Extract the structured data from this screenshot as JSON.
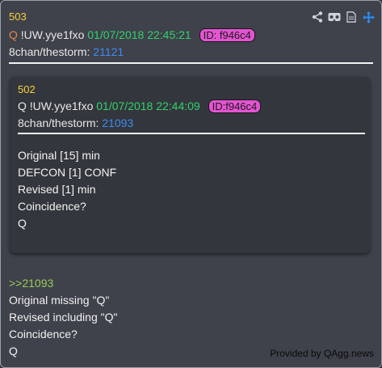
{
  "post": {
    "number": "503",
    "q": "Q",
    "trip": "!UW.yye1fxo",
    "date": "01/07/2018 22:45:21",
    "id": "ID: f946c4",
    "board": "8chan/thestorm:",
    "post_link": "21121",
    "reply_ref": ">>21093",
    "lines": [
      "Original missing \"Q\"",
      "Revised including \"Q\"",
      "Coincidence?",
      "Q"
    ]
  },
  "quoted": {
    "number": "502",
    "q": "Q",
    "trip": "!UW.yye1fxo",
    "date": "01/07/2018 22:44:09",
    "id": "ID:f946c4",
    "board": "8chan/thestorm:",
    "post_link": "21093",
    "lines": [
      "Original [15] min",
      "DEFCON [1] CONF",
      "Revised [1] min",
      "Coincidence?",
      "Q"
    ]
  },
  "toolbar": {
    "icons": [
      "share-icon",
      "vr-glasses-icon",
      "document-icon",
      "move-icon"
    ]
  },
  "footer": "Provided by QAgg.news",
  "colors": {
    "background": "#3f414b",
    "post_number": "#f3d23a",
    "date": "#2fd46a",
    "id_badge": "#e454d2",
    "link": "#3c8cf0",
    "greentext": "#9acb5a"
  }
}
